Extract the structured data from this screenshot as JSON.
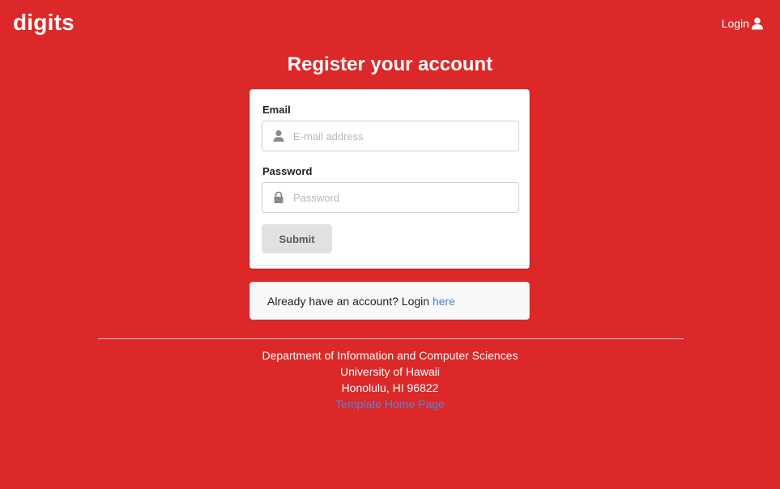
{
  "navbar": {
    "brand": "digits",
    "login_label": "Login",
    "login_icon": "user-icon"
  },
  "page": {
    "title": "Register your account"
  },
  "form": {
    "email_label": "Email",
    "email_placeholder": "E-mail address",
    "email_value": "",
    "email_icon": "user-icon",
    "password_label": "Password",
    "password_placeholder": "Password",
    "password_value": "",
    "password_icon": "lock-icon",
    "submit_label": "Submit"
  },
  "login_prompt": {
    "text": "Already have an account? Login ",
    "link": "here"
  },
  "footer": {
    "line1": "Department of Information and Computer Sciences",
    "line2": "University of Hawaii",
    "line3": "Honolulu, HI 96822",
    "link": "Template Home Page"
  },
  "colors": {
    "background": "#dc2828",
    "link": "#4183c4",
    "button": "#e0e1e2"
  }
}
